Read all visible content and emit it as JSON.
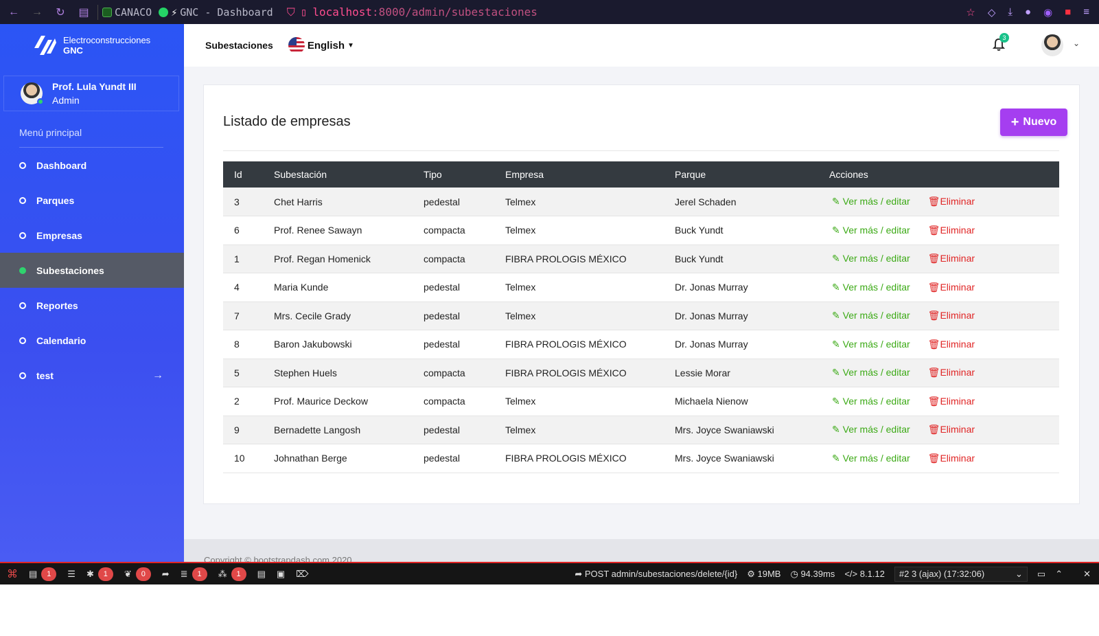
{
  "browser": {
    "bookmarks": [
      "CANACO",
      "GNC - Dashboard"
    ],
    "url_host": "localhost",
    "url_path": ":8000/admin/subestaciones"
  },
  "sidebar": {
    "brand_line1": "Electroconstrucciones",
    "brand_line2": "GNC",
    "profile_name": "Prof. Lula Yundt III",
    "profile_role": "Admin",
    "menu_title": "Menú principal",
    "items": [
      {
        "label": "Dashboard"
      },
      {
        "label": "Parques"
      },
      {
        "label": "Empresas"
      },
      {
        "label": "Subestaciones"
      },
      {
        "label": "Reportes"
      },
      {
        "label": "Calendario"
      },
      {
        "label": "test"
      }
    ]
  },
  "topbar": {
    "crumb": "Subestaciones",
    "language": "English",
    "notifications_count": "3"
  },
  "card": {
    "title": "Listado de empresas",
    "new_button": "Nuevo"
  },
  "table": {
    "headers": [
      "Id",
      "Subestación",
      "Tipo",
      "Empresa",
      "Parque",
      "Acciones"
    ],
    "edit_label": "Ver más / editar",
    "delete_label": "Eliminar",
    "rows": [
      {
        "id": "3",
        "subestacion": "Chet Harris",
        "tipo": "pedestal",
        "empresa": "Telmex",
        "parque": "Jerel Schaden"
      },
      {
        "id": "6",
        "subestacion": "Prof. Renee Sawayn",
        "tipo": "compacta",
        "empresa": "Telmex",
        "parque": "Buck Yundt"
      },
      {
        "id": "1",
        "subestacion": "Prof. Regan Homenick",
        "tipo": "compacta",
        "empresa": "FIBRA PROLOGIS MÉXICO",
        "parque": "Buck Yundt"
      },
      {
        "id": "4",
        "subestacion": "Maria Kunde",
        "tipo": "pedestal",
        "empresa": "Telmex",
        "parque": "Dr. Jonas Murray"
      },
      {
        "id": "7",
        "subestacion": "Mrs. Cecile Grady",
        "tipo": "pedestal",
        "empresa": "Telmex",
        "parque": "Dr. Jonas Murray"
      },
      {
        "id": "8",
        "subestacion": "Baron Jakubowski",
        "tipo": "pedestal",
        "empresa": "FIBRA PROLOGIS MÉXICO",
        "parque": "Dr. Jonas Murray"
      },
      {
        "id": "5",
        "subestacion": "Stephen Huels",
        "tipo": "compacta",
        "empresa": "FIBRA PROLOGIS MÉXICO",
        "parque": "Lessie Morar"
      },
      {
        "id": "2",
        "subestacion": "Prof. Maurice Deckow",
        "tipo": "compacta",
        "empresa": "Telmex",
        "parque": "Michaela Nienow"
      },
      {
        "id": "9",
        "subestacion": "Bernadette Langosh",
        "tipo": "pedestal",
        "empresa": "Telmex",
        "parque": "Mrs. Joyce Swaniawski"
      },
      {
        "id": "10",
        "subestacion": "Johnathan Berge",
        "tipo": "pedestal",
        "empresa": "FIBRA PROLOGIS MÉXICO",
        "parque": "Mrs. Joyce Swaniawski"
      }
    ]
  },
  "footer": {
    "copyright": "Copyright © bootstrapdash.com 2020"
  },
  "debugbar": {
    "counts": [
      "1",
      "1",
      "0",
      "1",
      "1"
    ],
    "request": "POST admin/subestaciones/delete/{id}",
    "memory": "19MB",
    "time": "94.39ms",
    "php": "8.1.12",
    "select": "#2 3 (ajax) (17:32:06)"
  },
  "colors": {
    "sidebar": "#2b55f5",
    "active_item": "#555a66",
    "accent": "#a53ef0",
    "edit": "#3caa16",
    "delete": "#e02424",
    "table_header": "#343a40"
  }
}
